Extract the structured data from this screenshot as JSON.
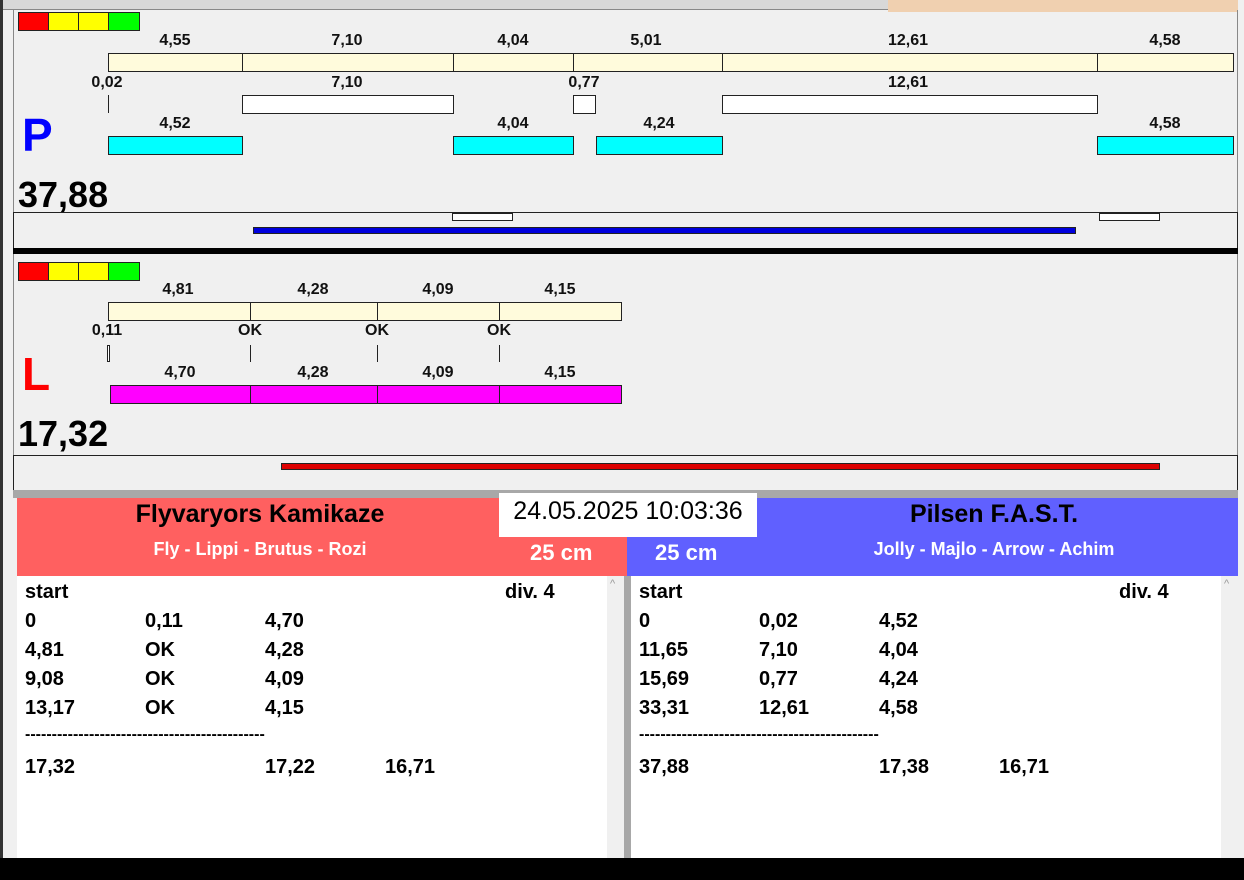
{
  "legend_colors": [
    "#ff0000",
    "#ffff00",
    "#ffff00",
    "#00ff00"
  ],
  "p_panel": {
    "letter": "P",
    "letter_color": "#0000ff",
    "total": "37,88",
    "row1": [
      "4,55",
      "7,10",
      "4,04",
      "5,01",
      "12,61",
      "4,58"
    ],
    "row2": [
      "0,02",
      "7,10",
      "0,77",
      "12,61"
    ],
    "row3": [
      "4,52",
      "4,04",
      "4,24",
      "4,58"
    ]
  },
  "l_panel": {
    "letter": "L",
    "letter_color": "#ff0000",
    "total": "17,32",
    "row1": [
      "4,81",
      "4,28",
      "4,09",
      "4,15"
    ],
    "row2": [
      "0,11",
      "OK",
      "OK",
      "OK"
    ],
    "row3": [
      "4,70",
      "4,28",
      "4,09",
      "4,15"
    ]
  },
  "datetime": "24.05.2025 10:03:36",
  "left_team": {
    "name": "Flyvaryors Kamikaze",
    "dogs": "Fly - Lippi - Brutus - Rozi",
    "height": "25 cm",
    "color": "#ff6060",
    "start": "start",
    "div": "div.  4",
    "rows": [
      [
        "0",
        "0,11",
        "4,70"
      ],
      [
        "4,81",
        "OK",
        "4,28"
      ],
      [
        "9,08",
        "OK",
        "4,09"
      ],
      [
        "13,17",
        "OK",
        "4,15"
      ]
    ],
    "separator": "---------------------------------------------",
    "totals": [
      "17,32",
      "17,22",
      "16,71"
    ]
  },
  "right_team": {
    "name": "Pilsen F.A.S.T.",
    "dogs": "Jolly - Majlo - Arrow - Achim",
    "height": "25 cm",
    "color": "#6060ff",
    "start": "start",
    "div": "div.  4",
    "rows": [
      [
        "0",
        "0,02",
        "4,52"
      ],
      [
        "11,65",
        "7,10",
        "4,04"
      ],
      [
        "15,69",
        "0,77",
        "4,24"
      ],
      [
        "33,31",
        "12,61",
        "4,58"
      ]
    ],
    "separator": "---------------------------------------------",
    "totals": [
      "37,88",
      "17,38",
      "16,71"
    ]
  }
}
